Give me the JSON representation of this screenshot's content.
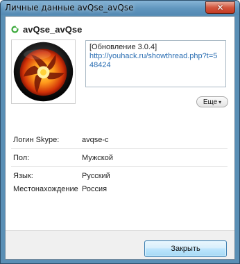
{
  "window": {
    "title": "Личные данные avQse_avQse",
    "close_glyph": "✕"
  },
  "profile": {
    "display_name": "avQse_avQse",
    "status_icon": "online-status-icon",
    "status_color": "#3aa83a",
    "mood_text": "[Обновление 3.0.4]",
    "mood_link": "http://youhack.ru/showthread.php?t=548424",
    "more_label": "Еще",
    "more_icon": "chevron-down-icon"
  },
  "details": [
    {
      "label": "Логин Skype:",
      "value": "avqse-c"
    },
    {
      "label": "Пол:",
      "value": "Мужской"
    },
    {
      "label": "Язык:",
      "value": "Русский"
    },
    {
      "label": "Местонахождение",
      "value": "Россия"
    }
  ],
  "footer": {
    "close_label": "Закрыть"
  },
  "colors": {
    "accent": "#3c7fb1",
    "link": "#2c6fb3"
  }
}
